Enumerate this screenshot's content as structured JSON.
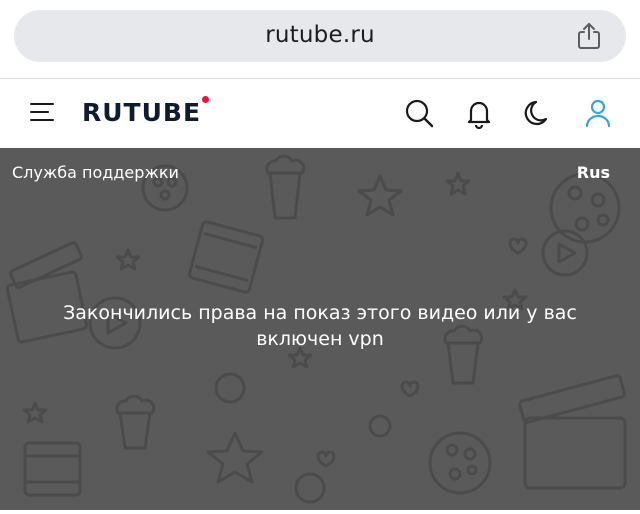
{
  "browser": {
    "url": "rutube.ru",
    "share_icon": "share-icon"
  },
  "header": {
    "logo_text": "RUTUBE",
    "logo_accent_color": "#ed143b",
    "icons": [
      "menu-icon",
      "search-icon",
      "bell-icon",
      "moon-icon",
      "user-icon"
    ],
    "user_icon_color": "#3aa3d8"
  },
  "player": {
    "support_link": "Служба поддержки",
    "language": "Rus",
    "message": "Закончились права на показ этого видео или у вас включен vpn",
    "background_color": "#5a5a5a"
  }
}
